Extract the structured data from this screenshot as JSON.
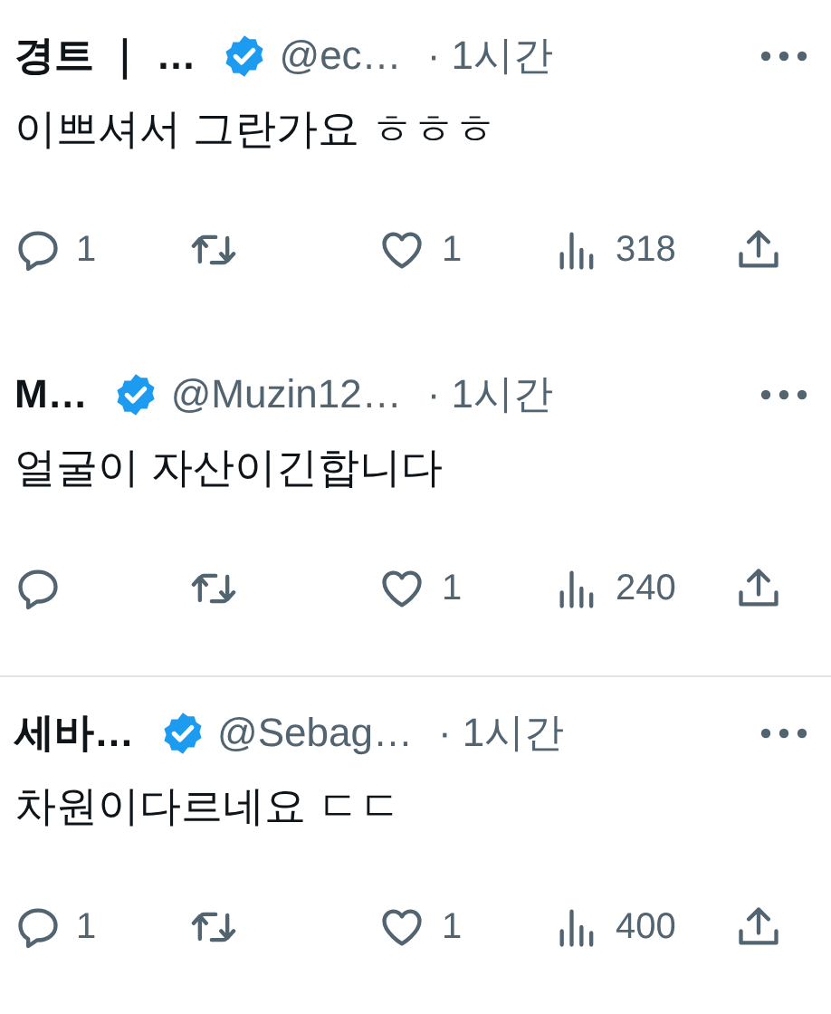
{
  "tweets": [
    {
      "name": "경트 ｜ …",
      "verified": true,
      "handle": "@ec…",
      "time": "· 1시간",
      "text": "이쁘셔서 그란가요 ㅎㅎㅎ",
      "replies": "1",
      "likes": "1",
      "views": "318",
      "divider": false
    },
    {
      "name": "M…",
      "verified": true,
      "handle": "@Muzin12…",
      "time": "· 1시간",
      "text": "얼굴이 자산이긴합니다",
      "likes": "1",
      "views": "240",
      "divider": true
    },
    {
      "name": "세바…",
      "verified": true,
      "handle": "@Sebag…",
      "time": "· 1시간",
      "text": "차원이다르네요 ㄷㄷ",
      "replies": "1",
      "likes": "1",
      "views": "400",
      "divider": false
    }
  ]
}
